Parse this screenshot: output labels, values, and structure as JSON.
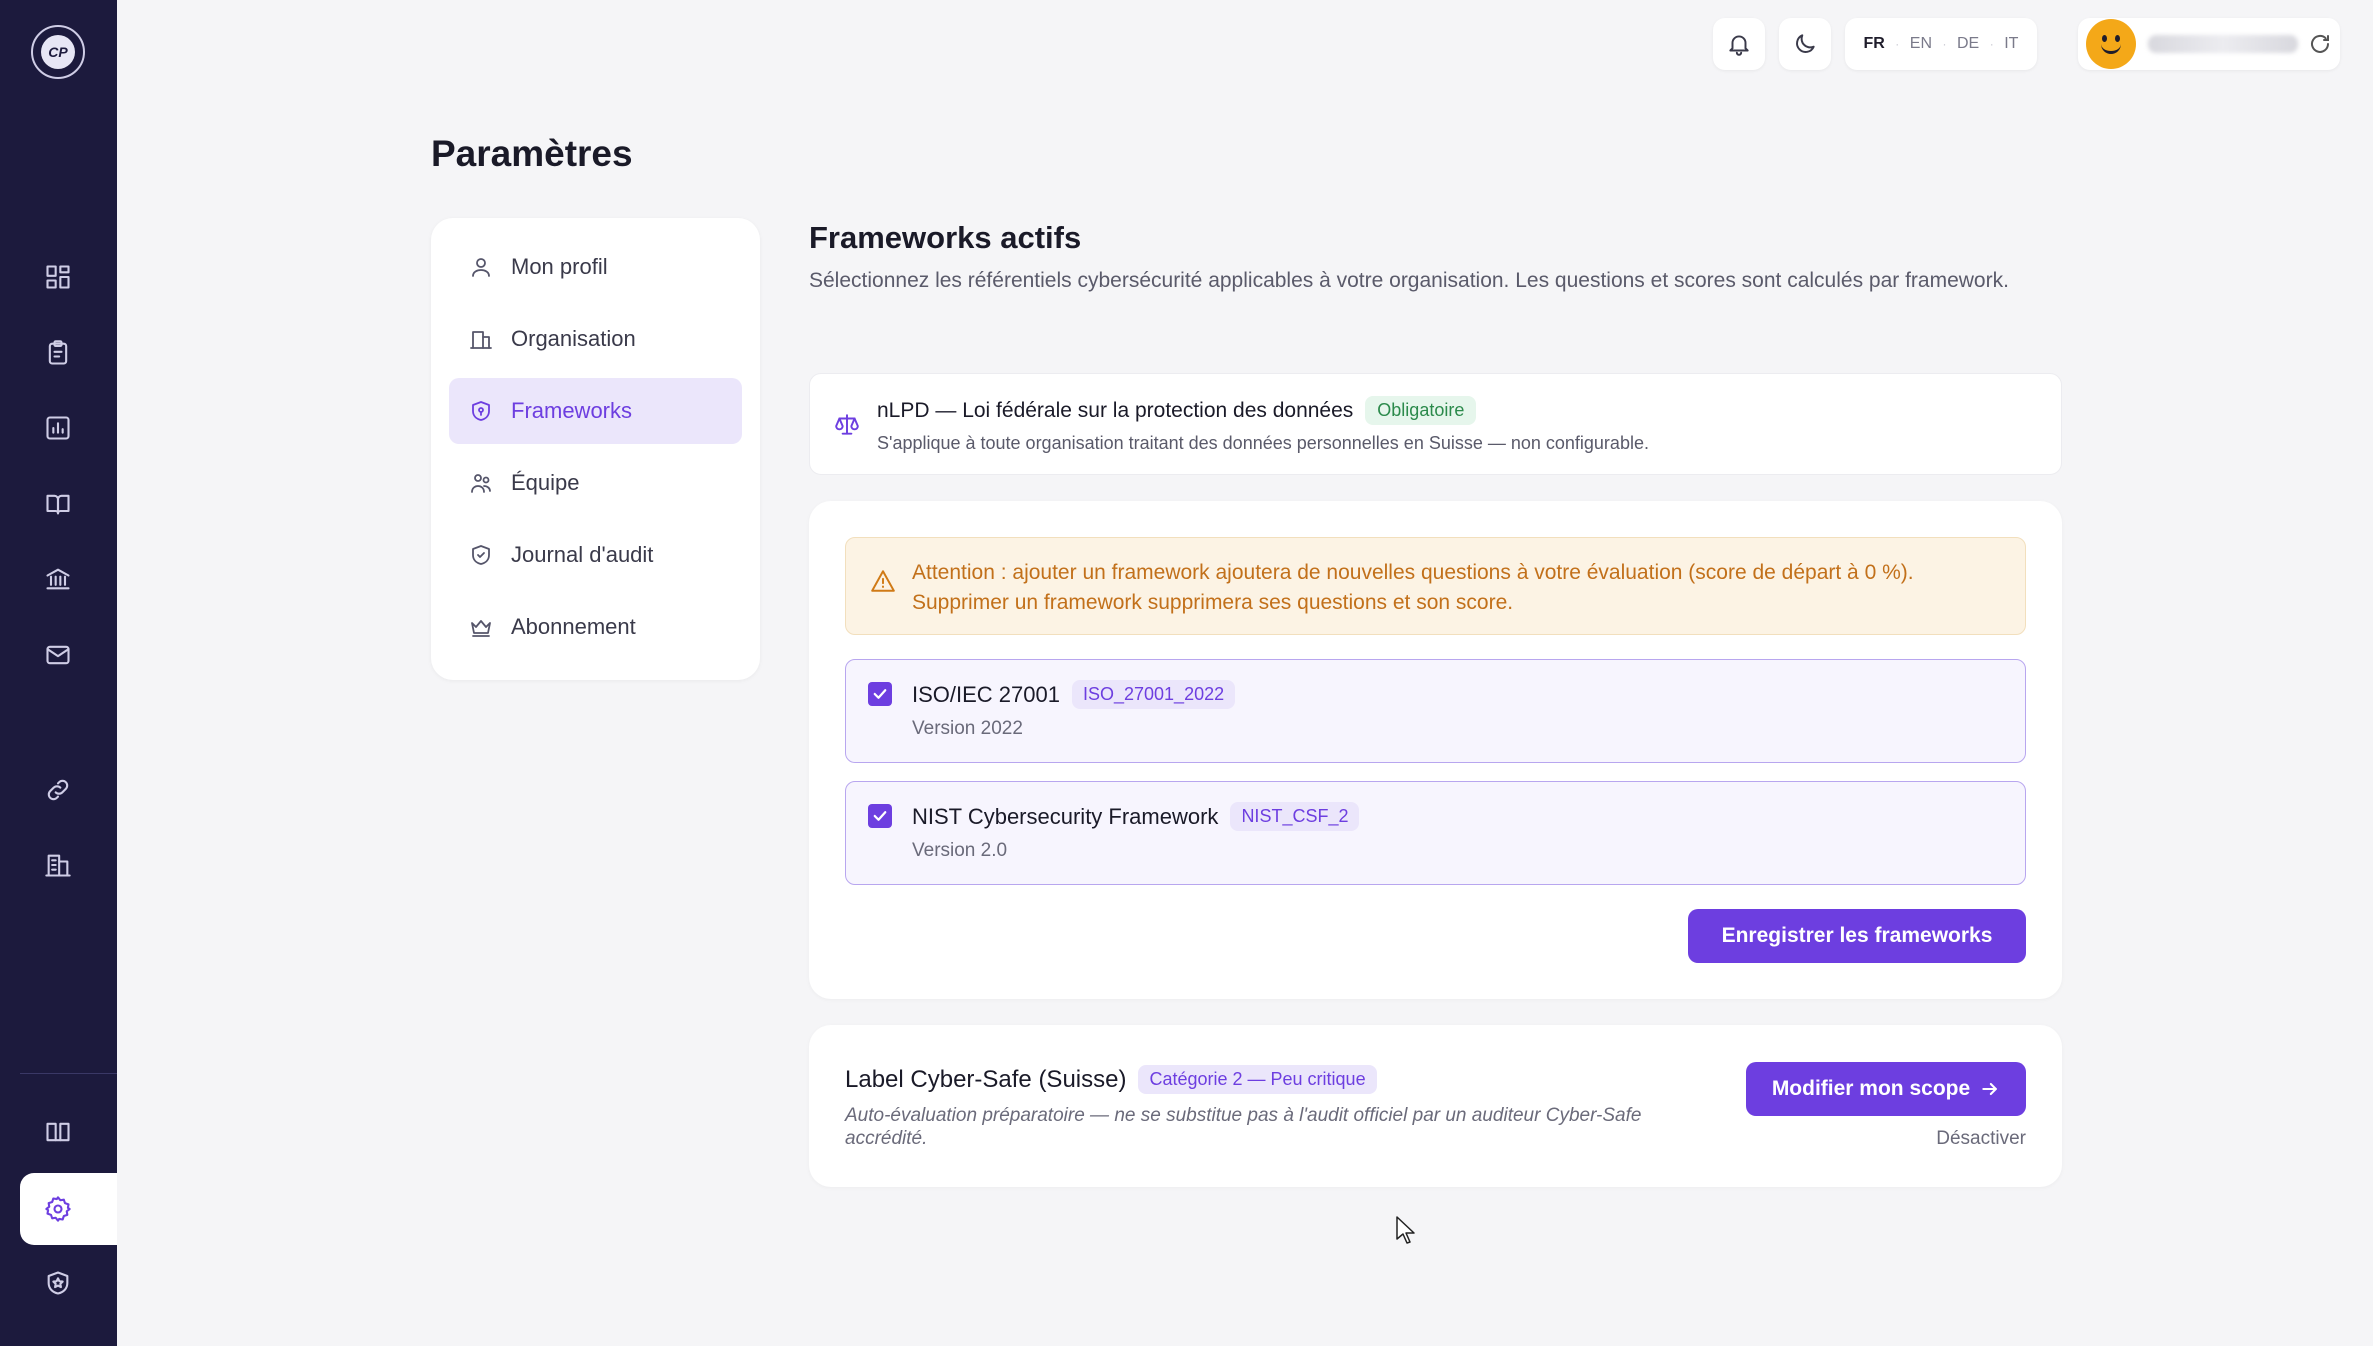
{
  "sidebar": {
    "logo_text": "CP",
    "nav": [
      {
        "icon": "dashboard-icon"
      },
      {
        "icon": "clipboard-icon"
      },
      {
        "icon": "chart-icon"
      },
      {
        "icon": "book-open-icon"
      },
      {
        "icon": "bank-icon"
      },
      {
        "icon": "mail-icon"
      },
      {
        "icon": "link-icon"
      },
      {
        "icon": "building-icon"
      },
      {
        "icon": "book-icon"
      },
      {
        "icon": "settings-icon",
        "active": true
      },
      {
        "icon": "shield-star-icon"
      }
    ]
  },
  "topbar": {
    "languages": [
      "FR",
      "EN",
      "DE",
      "IT"
    ],
    "active_language": "FR"
  },
  "page": {
    "title": "Paramètres"
  },
  "settings_menu": {
    "items": [
      {
        "label": "Mon profil",
        "icon": "user-icon"
      },
      {
        "label": "Organisation",
        "icon": "organisation-icon"
      },
      {
        "label": "Frameworks",
        "icon": "shield-icon",
        "active": true
      },
      {
        "label": "Équipe",
        "icon": "team-icon"
      },
      {
        "label": "Journal d'audit",
        "icon": "shield-check-icon"
      },
      {
        "label": "Abonnement",
        "icon": "crown-icon"
      }
    ]
  },
  "frameworks": {
    "title": "Frameworks actifs",
    "description": "Sélectionnez les référentiels cybersécurité applicables à votre organisation. Les questions et scores sont calculés par framework.",
    "mandatory": {
      "title": "nLPD — Loi fédérale sur la protection des données",
      "badge": "Obligatoire",
      "subtitle": "S'applique à toute organisation traitant des données personnelles en Suisse — non configurable."
    },
    "warning": "Attention : ajouter un framework ajoutera de nouvelles questions à votre évaluation (score de départ à 0 %). Supprimer un framework supprimera ses questions et son score.",
    "options": [
      {
        "name": "ISO/IEC 27001",
        "code": "ISO_27001_2022",
        "version": "Version 2022",
        "checked": true
      },
      {
        "name": "NIST Cybersecurity Framework",
        "code": "NIST_CSF_2",
        "version": "Version 2.0",
        "checked": true
      }
    ],
    "save_label": "Enregistrer les frameworks"
  },
  "label_card": {
    "title": "Label Cyber-Safe (Suisse)",
    "badge": "Catégorie 2 — Peu critique",
    "description": "Auto-évaluation préparatoire — ne se substitue pas à l'audit officiel par un auditeur Cyber-Safe accrédité.",
    "scope_button": "Modifier mon scope",
    "deactivate": "Désactiver"
  },
  "colors": {
    "sidebar": "#1c1a3d",
    "accent": "#6d3ee0",
    "warning": "#c2701a",
    "success": "#2b8a4b"
  }
}
